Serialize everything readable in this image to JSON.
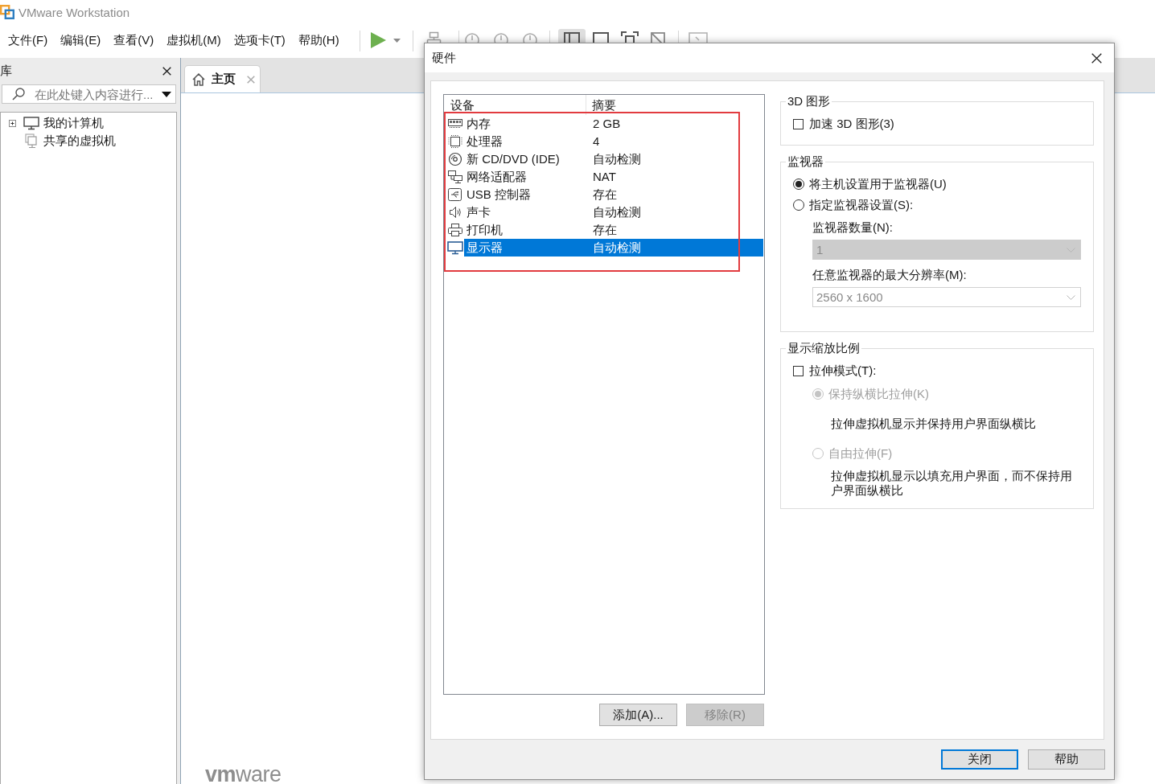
{
  "window": {
    "title": "VMware Workstation"
  },
  "menu_bar": [
    "文件(F)",
    "编辑(E)",
    "查看(V)",
    "虚拟机(M)",
    "选项卡(T)",
    "帮助(H)"
  ],
  "toolbar": {
    "view_buttons": [
      {
        "selected": true
      },
      {
        "selected": false
      },
      {
        "selected": false
      },
      {
        "selected": false
      }
    ]
  },
  "library": {
    "title": "库",
    "search": {
      "placeholder": "在此处键入内容进行..."
    },
    "tree": [
      {
        "kind": "computer",
        "label": "我的计算机",
        "expanded": false
      },
      {
        "kind": "shared",
        "label": "共享的虚拟机"
      }
    ]
  },
  "tabs": [
    {
      "label": "主页",
      "selected": true
    }
  ],
  "home": {
    "logo": "**vm**ware"
  },
  "dialog": {
    "title": "硬件",
    "devices": {
      "columns": [
        "设备",
        "摘要"
      ],
      "rows": [
        {
          "kind": "memory",
          "device": "内存",
          "summary": "2 GB",
          "selected": false
        },
        {
          "kind": "processor",
          "device": "处理器",
          "summary": "4",
          "selected": false
        },
        {
          "kind": "cd",
          "device": "新 CD/DVD (IDE)",
          "summary": "自动检测",
          "selected": false
        },
        {
          "kind": "network",
          "device": "网络适配器",
          "summary": "NAT",
          "selected": false
        },
        {
          "kind": "usb",
          "device": "USB 控制器",
          "summary": "存在",
          "selected": false
        },
        {
          "kind": "sound",
          "device": "声卡",
          "summary": "自动检测",
          "selected": false
        },
        {
          "kind": "printer",
          "device": "打印机",
          "summary": "存在",
          "selected": false
        },
        {
          "kind": "display",
          "device": "显示器",
          "summary": "自动检测",
          "selected": true
        }
      ]
    },
    "device_buttons": [
      {
        "label": "添加(A)...",
        "disabled": false
      },
      {
        "label": "移除(R)",
        "disabled": true
      }
    ],
    "settings": [
      {
        "title": "3D 图形",
        "items": [
          {
            "kind": "checkbox",
            "label": "加速 3D 图形(3)",
            "checked": false,
            "disabled": false
          }
        ]
      },
      {
        "title": "监视器",
        "items": [
          {
            "kind": "radio",
            "label": "将主机设置用于监视器(U)",
            "checked": true,
            "disabled": false
          },
          {
            "kind": "radio",
            "label": "指定监视器设置(S):",
            "checked": false,
            "disabled": false,
            "children": [
              {
                "kind": "combo",
                "label": "监视器数量(N):",
                "value": "1",
                "disabled": true
              },
              {
                "kind": "dropdown",
                "label": "任意监视器的最大分辨率(M):",
                "value": "2560 x 1600",
                "disabled": true
              }
            ]
          }
        ]
      },
      {
        "title": "显示缩放比例",
        "items": [
          {
            "kind": "checkbox",
            "label": "拉伸模式(T):",
            "checked": false,
            "disabled": false,
            "children": [
              {
                "kind": "radio",
                "label": "保持纵横比拉伸(K)",
                "checked": true,
                "disabled": true,
                "description": "拉伸虚拟机显示并保持用户界面纵横比"
              },
              {
                "kind": "radio",
                "label": "自由拉伸(F)",
                "checked": false,
                "disabled": true,
                "description": "拉伸虚拟机显示以填充用户界面，而不保持用户界面纵横比"
              }
            ]
          }
        ]
      }
    ],
    "buttons": [
      {
        "label": "关闭",
        "default": true
      },
      {
        "label": "帮助",
        "default": false
      }
    ]
  }
}
